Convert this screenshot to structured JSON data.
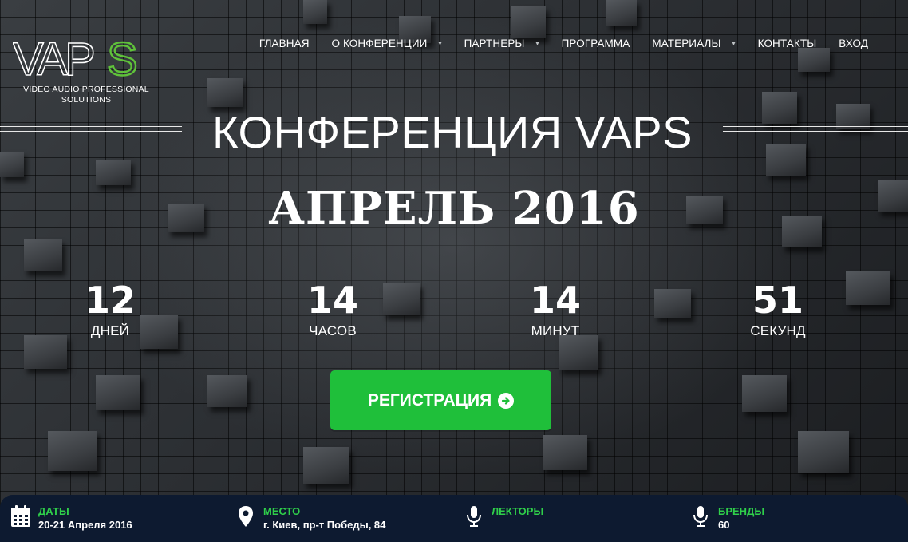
{
  "logo": {
    "mark": "VAPS",
    "subtitle_line1": "VIDEO AUDIO PROFESSIONAL",
    "subtitle_line2": "SOLUTIONS",
    "accent_color": "#5fc23a"
  },
  "nav": {
    "items": [
      {
        "label": "ГЛАВНАЯ",
        "dropdown": false
      },
      {
        "label": "О КОНФЕРЕНЦИИ",
        "dropdown": true
      },
      {
        "label": "ПАРТНЕРЫ",
        "dropdown": true
      },
      {
        "label": "ПРОГРАММА",
        "dropdown": false
      },
      {
        "label": "МАТЕРИАЛЫ",
        "dropdown": true
      },
      {
        "label": "КОНТАКТЫ",
        "dropdown": false
      },
      {
        "label": "ВХОД",
        "dropdown": false
      }
    ],
    "caret_glyph": "▾"
  },
  "hero": {
    "title": "КОНФЕРЕНЦИЯ VAPS",
    "subtitle": "АПРЕЛЬ 2016"
  },
  "countdown": {
    "days": {
      "value": "12",
      "label": "ДНЕЙ"
    },
    "hours": {
      "value": "14",
      "label": "ЧАСОВ"
    },
    "minutes": {
      "value": "14",
      "label": "МИНУТ"
    },
    "seconds": {
      "value": "51",
      "label": "СЕКУНД"
    }
  },
  "register": {
    "label": "РЕГИСТРАЦИЯ",
    "color": "#1fbf3a",
    "icon": "arrow-circle-right-icon"
  },
  "info": {
    "dates": {
      "label": "ДАТЫ",
      "value": "20-21 Апреля 2016",
      "icon": "calendar-icon"
    },
    "place": {
      "label": "МЕСТО",
      "value": "г. Киев, пр-т Победы, 84",
      "icon": "map-marker-icon"
    },
    "speakers": {
      "label": "ЛЕКТОРЫ",
      "value": "",
      "icon": "microphone-icon"
    },
    "brands": {
      "label": "БРЕНДЫ",
      "value": "60",
      "icon": "microphone-icon"
    },
    "bar_color": "#0d1a30",
    "label_color": "#2fcf4a"
  }
}
